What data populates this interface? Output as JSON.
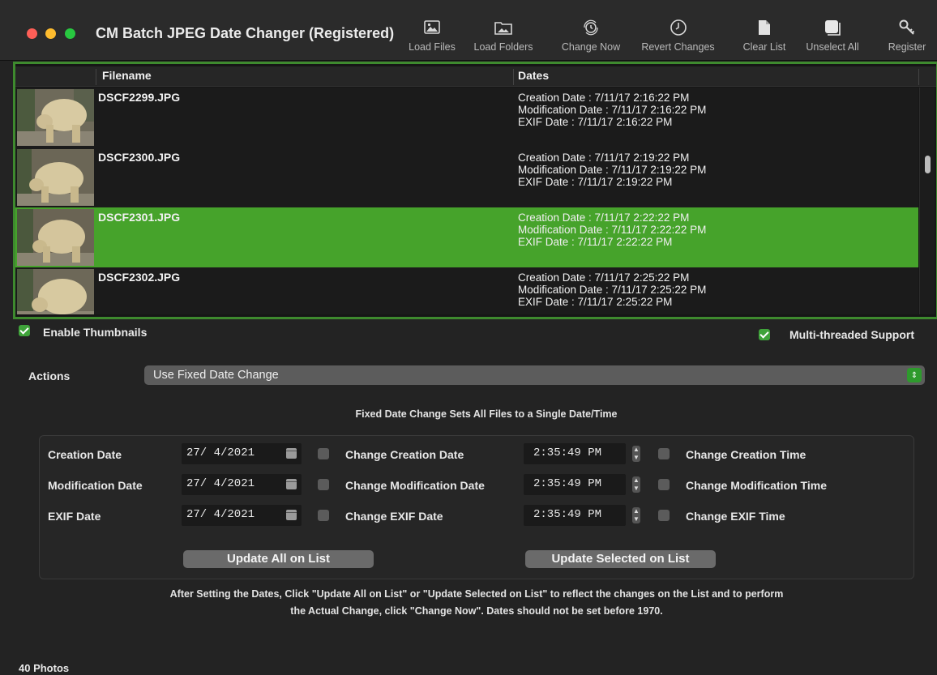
{
  "window": {
    "title": "CM Batch JPEG Date Changer (Registered)"
  },
  "toolbar": {
    "items": [
      {
        "label": "Load Files",
        "icon": "image-icon"
      },
      {
        "label": "Load Folders",
        "icon": "folder-image-icon"
      },
      {
        "label": "Change Now",
        "icon": "clock-refresh-icon"
      },
      {
        "label": "Revert Changes",
        "icon": "clock-icon"
      },
      {
        "label": "Clear List",
        "icon": "document-icon"
      },
      {
        "label": "Unselect All",
        "icon": "square-stack-icon"
      },
      {
        "label": "Register",
        "icon": "key-icon"
      }
    ]
  },
  "table": {
    "columns": [
      "Filename",
      "Dates"
    ],
    "rows": [
      {
        "filename": "DSCF2299.JPG",
        "creation": "Creation Date : 7/11/17 2:16:22 PM",
        "modification": "Modification Date : 7/11/17 2:16:22 PM",
        "exif": "EXIF Date : 7/11/17 2:16:22 PM",
        "selected": false
      },
      {
        "filename": "DSCF2300.JPG",
        "creation": "Creation Date : 7/11/17 2:19:22 PM",
        "modification": "Modification Date : 7/11/17 2:19:22 PM",
        "exif": "EXIF Date : 7/11/17 2:19:22 PM",
        "selected": false
      },
      {
        "filename": "DSCF2301.JPG",
        "creation": "Creation Date : 7/11/17 2:22:22 PM",
        "modification": "Modification Date : 7/11/17 2:22:22 PM",
        "exif": "EXIF Date : 7/11/17 2:22:22 PM",
        "selected": true
      },
      {
        "filename": "DSCF2302.JPG",
        "creation": "Creation Date : 7/11/17 2:25:22 PM",
        "modification": "Modification Date : 7/11/17 2:25:22 PM",
        "exif": "EXIF Date : 7/11/17 2:25:22 PM",
        "selected": false
      }
    ]
  },
  "options": {
    "enable_thumbnails": "Enable Thumbnails",
    "multithreaded": "Multi-threaded Support"
  },
  "actions": {
    "label": "Actions",
    "selected": "Use Fixed Date Change"
  },
  "fixed": {
    "description": "Fixed Date Change Sets All Files to a Single Date/Time",
    "rows": [
      {
        "label": "Creation Date",
        "date": "27/ 4/2021",
        "change_date": "Change Creation Date",
        "time": "2:35:49 PM",
        "change_time": "Change Creation Time"
      },
      {
        "label": "Modification Date",
        "date": "27/ 4/2021",
        "change_date": "Change Modification Date",
        "time": "2:35:49 PM",
        "change_time": "Change Modification Time"
      },
      {
        "label": "EXIF Date",
        "date": "27/ 4/2021",
        "change_date": "Change EXIF Date",
        "time": "2:35:49 PM",
        "change_time": "Change EXIF Time"
      }
    ],
    "update_all": "Update All on List",
    "update_selected": "Update Selected on List"
  },
  "note": {
    "line1": "After Setting the Dates, Click \"Update All on List\" or \"Update Selected on List\" to reflect the changes on the List and to perform",
    "line2": "the Actual Change, click \"Change Now\". Dates should not be set before 1970."
  },
  "status": {
    "count": "40 Photos"
  },
  "colors": {
    "accent": "#46a32b",
    "border": "#3e8a2e"
  }
}
